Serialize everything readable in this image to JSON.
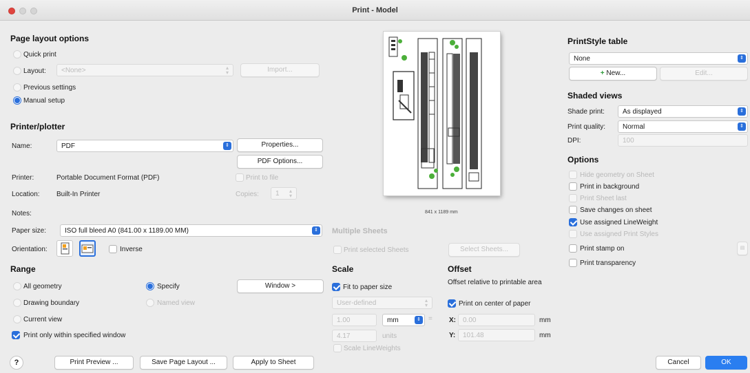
{
  "window": {
    "title": "Print - Model"
  },
  "page_layout": {
    "heading": "Page layout options",
    "quick_print": "Quick print",
    "layout_label": "Layout:",
    "layout_value": "<None>",
    "import_button": "Import...",
    "previous_settings": "Previous settings",
    "manual_setup": "Manual setup"
  },
  "printer": {
    "heading": "Printer/plotter",
    "name_label": "Name:",
    "name_value": "PDF",
    "properties_button": "Properties...",
    "pdf_options_button": "PDF Options...",
    "printer_label": "Printer:",
    "printer_value": "Portable Document Format (PDF)",
    "location_label": "Location:",
    "location_value": "Built-In Printer",
    "print_to_file": "Print to file",
    "copies_label": "Copies:",
    "copies_value": "1",
    "notes_label": "Notes:",
    "paper_size_label": "Paper size:",
    "paper_size_value": "ISO full bleed A0 (841.00 x 1189.00 MM)",
    "orientation_label": "Orientation:",
    "inverse": "Inverse"
  },
  "preview": {
    "size_caption": "841 x 1189 mm"
  },
  "range": {
    "heading": "Range",
    "all_geometry": "All geometry",
    "specify": "Specify",
    "window_button": "Window >",
    "drawing_boundary": "Drawing boundary",
    "named_view": "Named view",
    "current_view": "Current view",
    "print_only_within": "Print only within specified window"
  },
  "multiple_sheets": {
    "heading": "Multiple Sheets",
    "print_selected": "Print selected Sheets",
    "select_sheets_button": "Select Sheets..."
  },
  "scale": {
    "heading": "Scale",
    "fit_to_paper": "Fit to paper size",
    "scale_value": "User-defined",
    "value1": "1.00",
    "unit1": "mm",
    "value2": "4.17",
    "unit2": "units",
    "scale_lineweights": "Scale LineWeights"
  },
  "offset": {
    "heading": "Offset",
    "description": "Offset relative to printable area",
    "center_on_paper": "Print on center of paper",
    "x_label": "X:",
    "x_value": "0.00",
    "x_unit": "mm",
    "y_label": "Y:",
    "y_value": "101.48",
    "y_unit": "mm"
  },
  "printstyle": {
    "heading": "PrintStyle table",
    "value": "None",
    "new_button": "New...",
    "edit_button": "Edit..."
  },
  "shaded_views": {
    "heading": "Shaded views",
    "shade_print_label": "Shade print:",
    "shade_print_value": "As displayed",
    "print_quality_label": "Print quality:",
    "print_quality_value": "Normal",
    "dpi_label": "DPI:",
    "dpi_value": "100"
  },
  "options": {
    "heading": "Options",
    "hide_geometry": "Hide geometry on Sheet",
    "print_background": "Print in background",
    "print_sheet_last": "Print Sheet last",
    "save_changes": "Save changes on sheet",
    "use_lineweight": "Use assigned LineWeight",
    "use_print_styles": "Use assigned Print Styles",
    "print_stamp": "Print stamp on",
    "print_transparency": "Print transparency"
  },
  "footer": {
    "help": "?",
    "print_preview": "Print Preview ...",
    "save_layout": "Save Page Layout ...",
    "apply_sheet": "Apply to Sheet",
    "cancel": "Cancel",
    "ok": "OK"
  },
  "colors": {
    "accent": "#2a6fdb",
    "ok_button": "#2a7ef0",
    "close_dot": "#e0443e"
  }
}
